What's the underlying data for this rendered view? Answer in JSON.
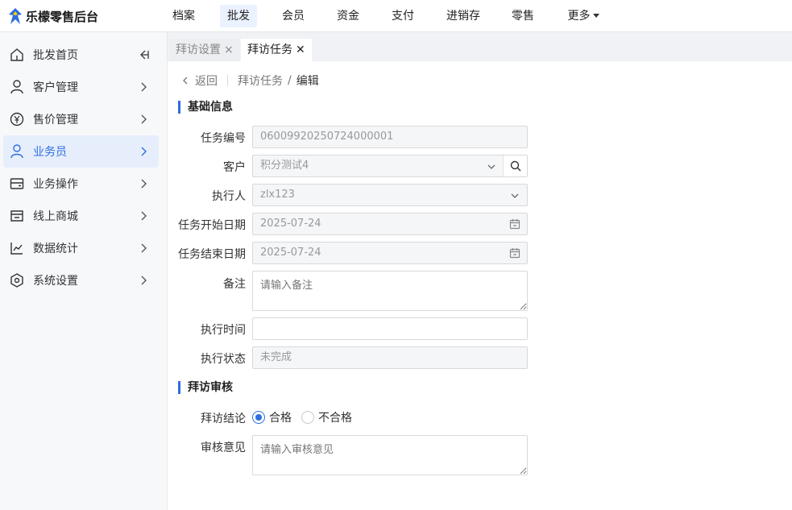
{
  "app": {
    "title": "乐檬零售后台"
  },
  "topnav": {
    "items": [
      "档案",
      "批发",
      "会员",
      "资金",
      "支付",
      "进销存",
      "零售",
      "更多"
    ],
    "active": "批发"
  },
  "sidebar": {
    "collapse_icon": "collapse-left-icon",
    "items": [
      {
        "label": "批发首页",
        "icon": "home-icon"
      },
      {
        "label": "客户管理",
        "icon": "user-icon"
      },
      {
        "label": "售价管理",
        "icon": "yen-icon"
      },
      {
        "label": "业务员",
        "icon": "user-icon",
        "active": true
      },
      {
        "label": "业务操作",
        "icon": "card-icon"
      },
      {
        "label": "线上商城",
        "icon": "store-icon"
      },
      {
        "label": "数据统计",
        "icon": "chart-icon"
      },
      {
        "label": "系统设置",
        "icon": "settings-icon"
      }
    ]
  },
  "tabs": [
    {
      "label": "拜访设置",
      "close": "×"
    },
    {
      "label": "拜访任务",
      "close": "✕"
    }
  ],
  "breadcrumb": {
    "back": "返回",
    "parent": "拜访任务",
    "separator": "/",
    "current": "编辑"
  },
  "basic": {
    "title": "基础信息",
    "task_no_label": "任务编号",
    "task_no": "06009920250724000001",
    "customer_label": "客户",
    "customer": "积分测试4",
    "executor_label": "执行人",
    "executor": "zlx123",
    "start_label": "任务开始日期",
    "start": "2025-07-24",
    "end_label": "任务结束日期",
    "end": "2025-07-24",
    "remark_label": "备注",
    "remark_placeholder": "请输入备注",
    "exec_time_label": "执行时间",
    "exec_time": "",
    "exec_status_label": "执行状态",
    "exec_status": "未完成"
  },
  "review": {
    "title": "拜访审核",
    "conclusion_label": "拜访结论",
    "options": [
      "合格",
      "不合格"
    ],
    "selected": "合格",
    "opinion_label": "审核意见",
    "opinion_placeholder": "请输入审核意见"
  },
  "colors": {
    "accent": "#2d6ee0",
    "active_bg": "#e6eefc"
  }
}
